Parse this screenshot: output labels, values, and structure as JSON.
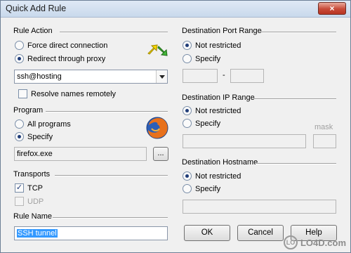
{
  "window": {
    "title": "Quick Add Rule",
    "close_glyph": "×"
  },
  "rule_action": {
    "title": "Rule Action",
    "options": [
      "Force direct connection",
      "Redirect through proxy"
    ],
    "selected": 1,
    "proxy_value": "ssh@hosting",
    "resolve_label": "Resolve names remotely"
  },
  "program": {
    "title": "Program",
    "options": [
      "All programs",
      "Specify"
    ],
    "selected": 1,
    "value": "firefox.exe",
    "browse_label": "..."
  },
  "transports": {
    "title": "Transports",
    "tcp_label": "TCP",
    "udp_label": "UDP",
    "check_glyph": "✓"
  },
  "rule_name": {
    "title": "Rule Name",
    "value": "SSH tunnel"
  },
  "dest_port": {
    "title": "Destination Port Range",
    "options": [
      "Not restricted",
      "Specify"
    ],
    "selected": 0,
    "separator": "-"
  },
  "dest_ip": {
    "title": "Destination IP Range",
    "options": [
      "Not restricted",
      "Specify"
    ],
    "selected": 0,
    "mask_label": "mask"
  },
  "dest_host": {
    "title": "Destination Hostname",
    "options": [
      "Not restricted",
      "Specify"
    ],
    "selected": 0
  },
  "buttons": {
    "ok": "OK",
    "cancel": "Cancel",
    "help": "Help"
  },
  "watermark": {
    "text": "LO4D.com",
    "mark": "LO"
  },
  "colors": {
    "accent": "#3399ff",
    "radio_dot": "#1f3c78"
  }
}
